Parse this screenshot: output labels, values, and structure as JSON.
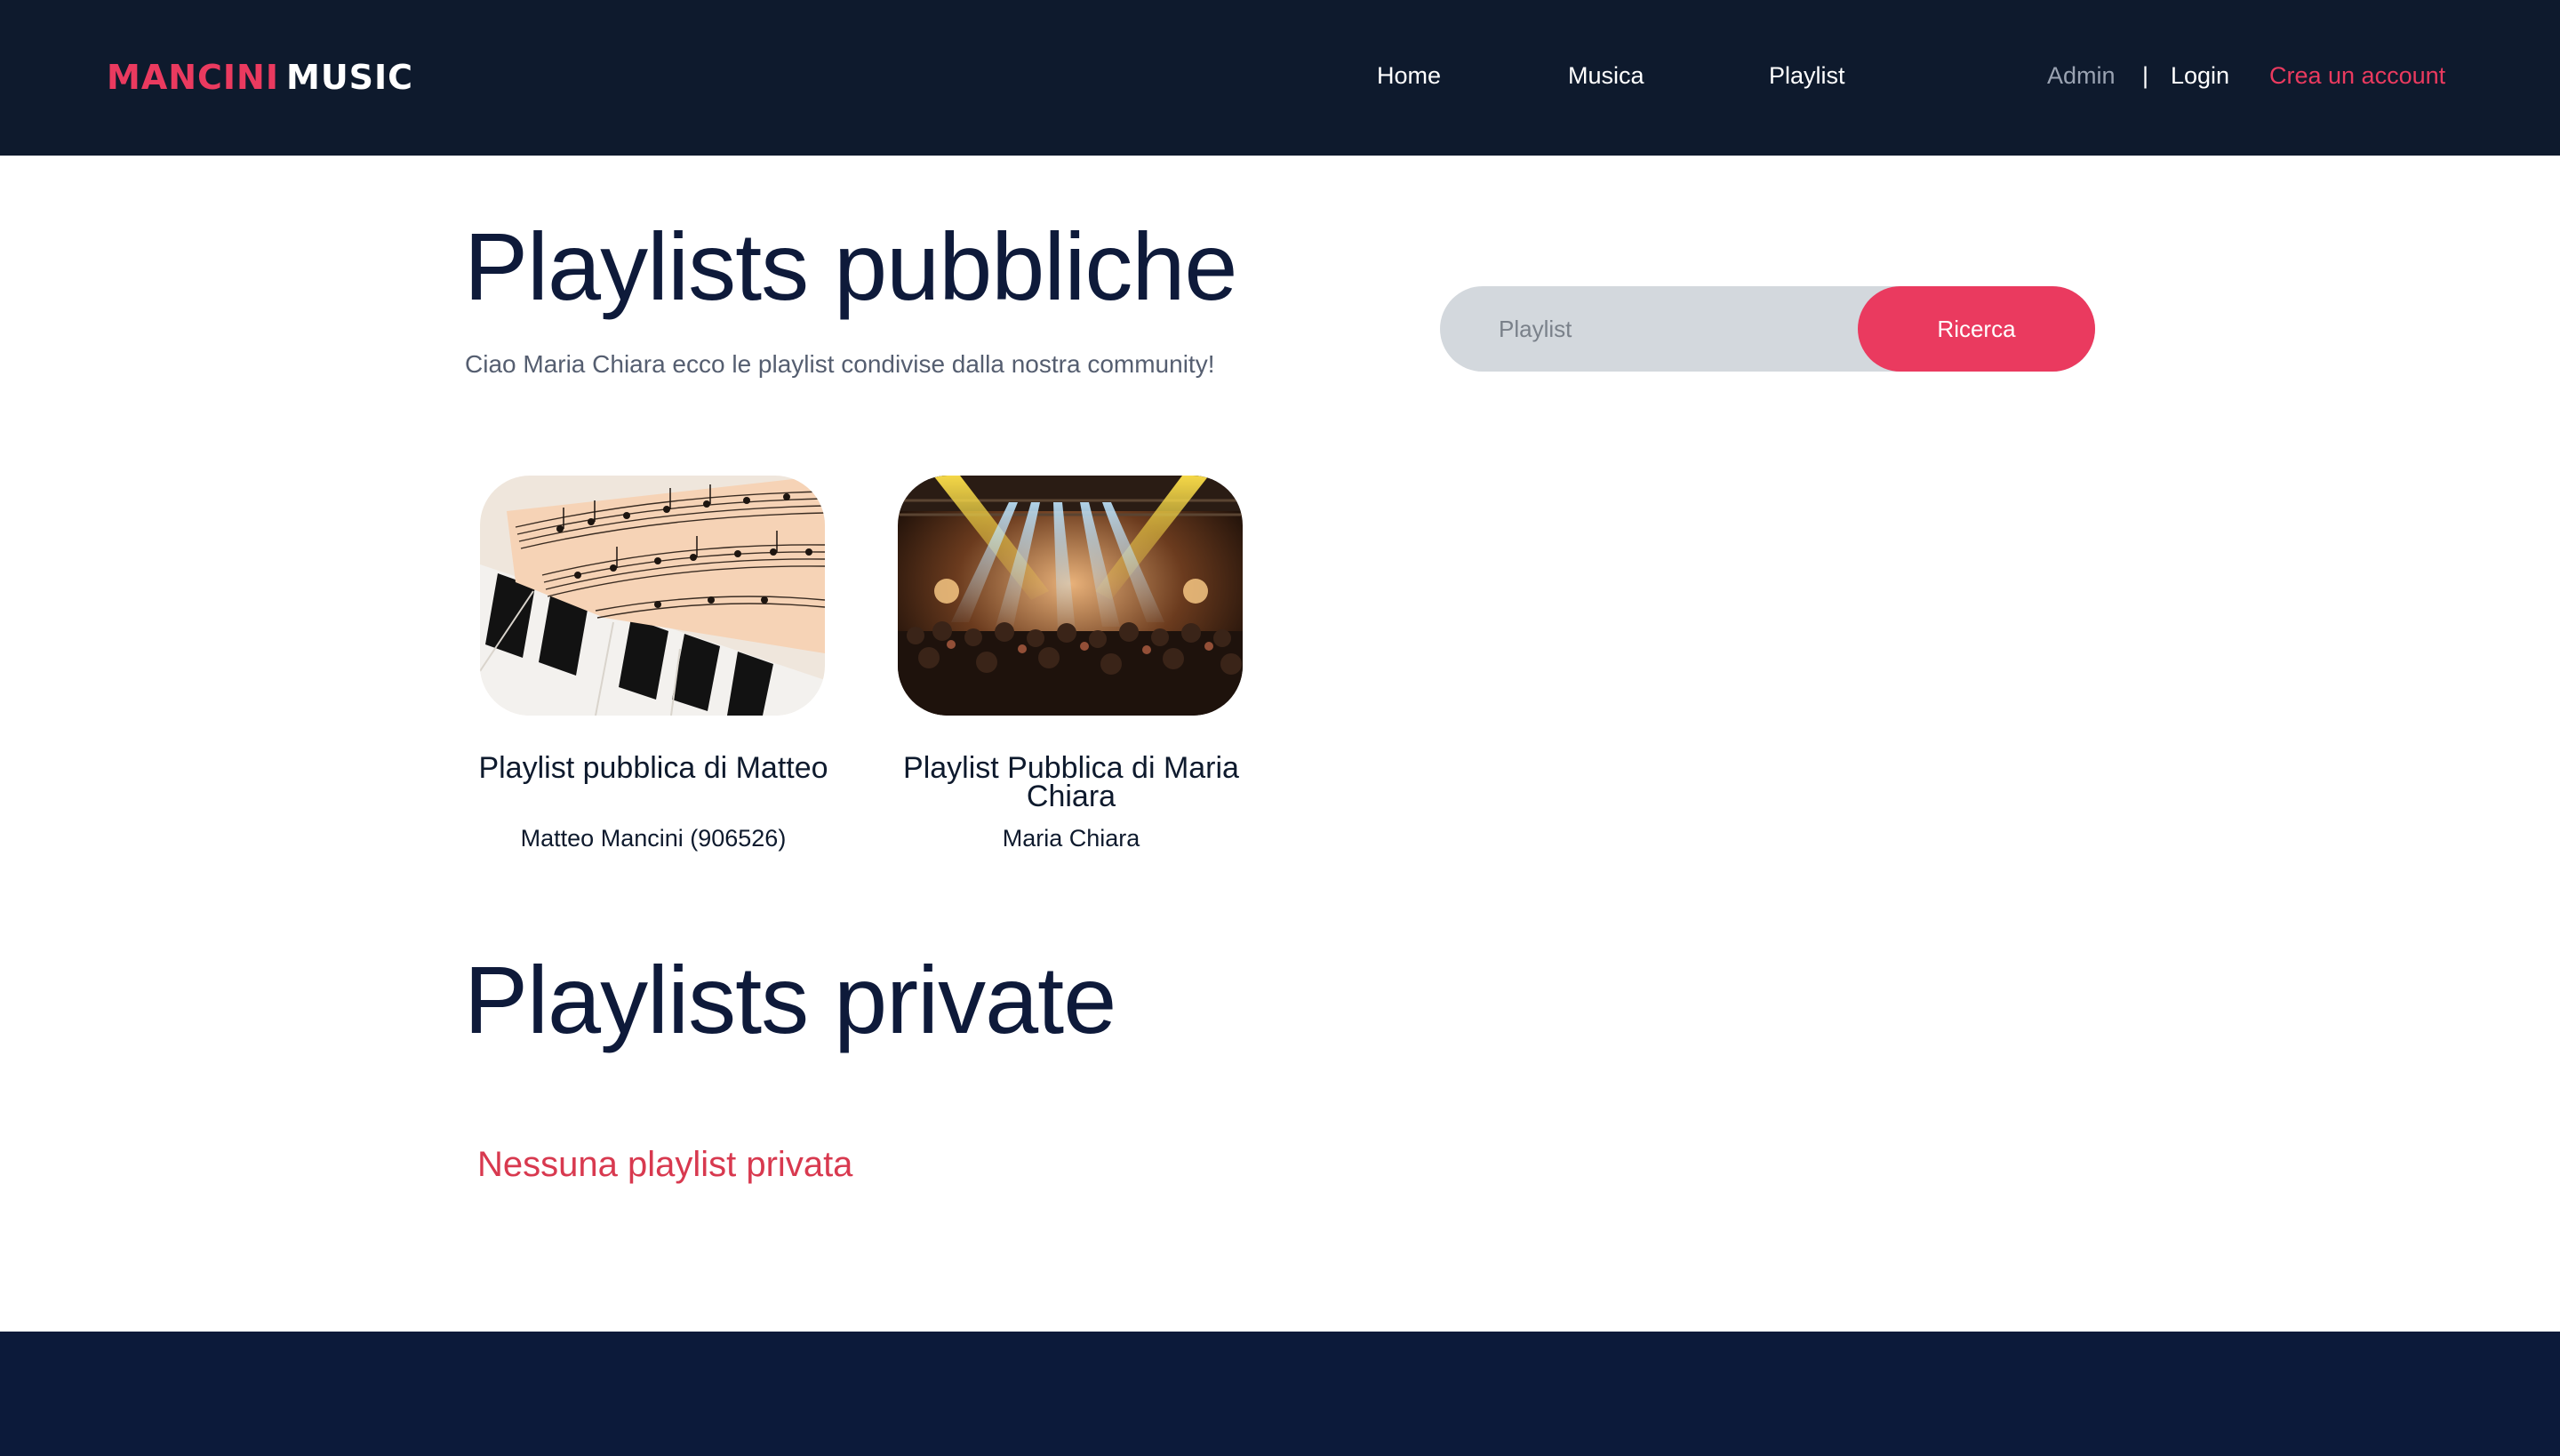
{
  "header": {
    "brand_part1": "MANCINI",
    "brand_part2": "MUSIC",
    "nav": {
      "home": "Home",
      "music": "Musica",
      "playlist": "Playlist"
    },
    "auth": {
      "admin": "Admin",
      "separator": "|",
      "login": "Login",
      "register": "Crea un account"
    }
  },
  "public_section": {
    "title": "Playlists pubbliche",
    "subtitle": "Ciao Maria Chiara ecco le playlist condivise dalla nostra community!"
  },
  "search": {
    "placeholder": "Playlist",
    "button_label": "Ricerca"
  },
  "playlists": [
    {
      "title": "Playlist pubblica di Matteo",
      "owner": "Matteo Mancini (906526)",
      "image": "sheet-music-piano-image"
    },
    {
      "title": "Playlist Pubblica di Maria Chiara",
      "owner": "Maria Chiara",
      "image": "concert-crowd-image"
    }
  ],
  "private_section": {
    "title": "Playlists private",
    "empty_message": "Nessuna playlist privata"
  },
  "colors": {
    "header_bg": "#0e1a2d",
    "accent": "#ea3a5f",
    "title_text": "#0e1a3a",
    "footer_bg": "#0c1a3a",
    "search_bg": "#d3d8dd"
  }
}
